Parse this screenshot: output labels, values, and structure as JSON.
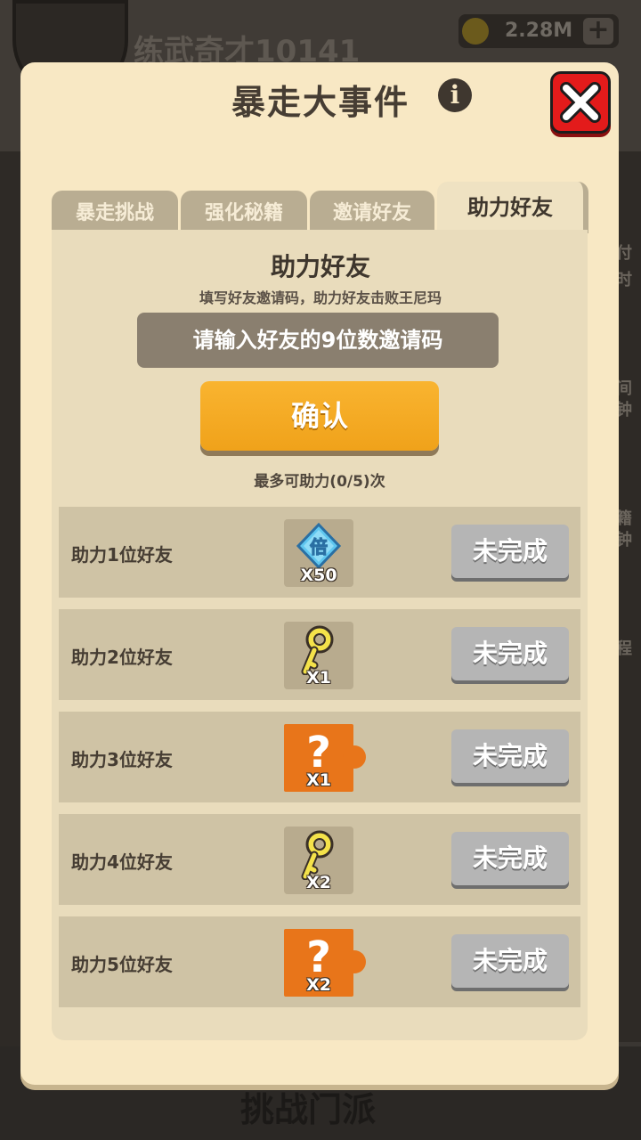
{
  "background": {
    "player_name": "练武奇才10141",
    "coins": "2.28M",
    "side_labels": [
      "付",
      "时",
      "间",
      "钟",
      "籍",
      "钟",
      "程"
    ],
    "bottom_label": "挑战门派"
  },
  "modal": {
    "title": "暴走大事件",
    "info_icon": "info-icon",
    "close_icon": "close-icon"
  },
  "tabs": [
    {
      "label": "暴走挑战",
      "active": false
    },
    {
      "label": "强化秘籍",
      "active": false
    },
    {
      "label": "邀请好友",
      "active": false
    },
    {
      "label": "助力好友",
      "active": true
    }
  ],
  "help": {
    "title": "助力好友",
    "subtitle": "填写好友邀请码，助力好友击败王尼玛",
    "input_placeholder": "请输入好友的9位数邀请码",
    "confirm_label": "确认",
    "limit_text": "最多可助力(0/5)次"
  },
  "rewards": [
    {
      "label": "助力1位好友",
      "icon": "multiplier-gem-icon",
      "icon_text": "倍",
      "qty": "X50",
      "status": "未完成"
    },
    {
      "label": "助力2位好友",
      "icon": "key-icon",
      "qty": "X1",
      "status": "未完成"
    },
    {
      "label": "助力3位好友",
      "icon": "mystery-puzzle-icon",
      "qty": "X1",
      "status": "未完成"
    },
    {
      "label": "助力4位好友",
      "icon": "key-icon",
      "qty": "X2",
      "status": "未完成"
    },
    {
      "label": "助力5位好友",
      "icon": "mystery-puzzle-icon",
      "qty": "X2",
      "status": "未完成"
    }
  ],
  "colors": {
    "modal_bg": "#f8e8c4",
    "confirm": "#f5a623",
    "close": "#e31b1b",
    "status_incomplete": "#b5b5b5"
  }
}
